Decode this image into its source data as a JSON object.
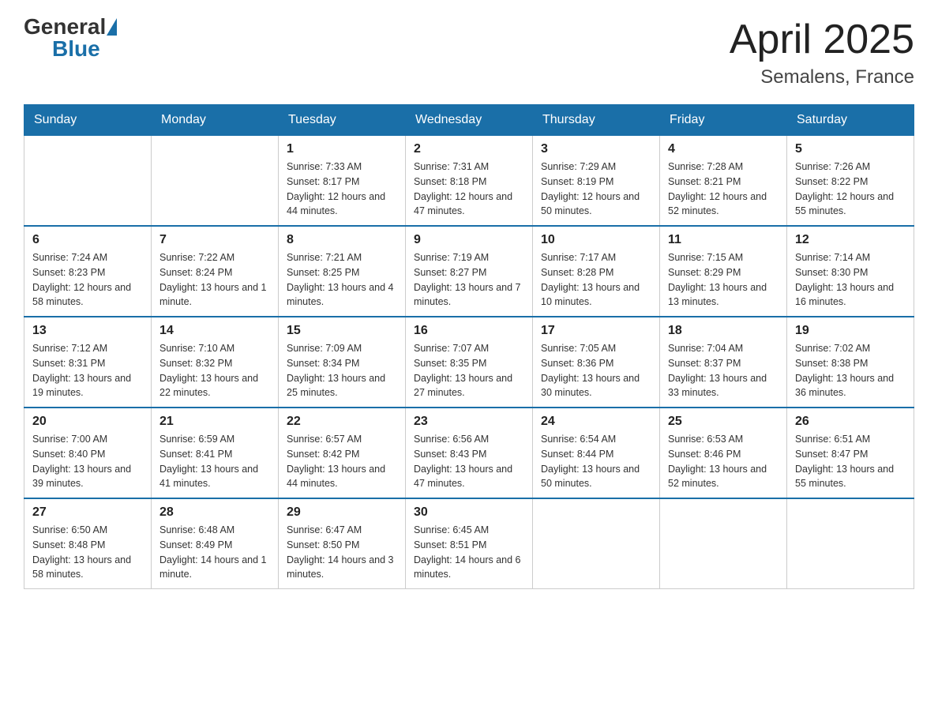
{
  "header": {
    "logo_general": "General",
    "logo_blue": "Blue",
    "month_year": "April 2025",
    "location": "Semalens, France"
  },
  "days_of_week": [
    "Sunday",
    "Monday",
    "Tuesday",
    "Wednesday",
    "Thursday",
    "Friday",
    "Saturday"
  ],
  "weeks": [
    [
      {
        "day": "",
        "sunrise": "",
        "sunset": "",
        "daylight": ""
      },
      {
        "day": "",
        "sunrise": "",
        "sunset": "",
        "daylight": ""
      },
      {
        "day": "1",
        "sunrise": "Sunrise: 7:33 AM",
        "sunset": "Sunset: 8:17 PM",
        "daylight": "Daylight: 12 hours and 44 minutes."
      },
      {
        "day": "2",
        "sunrise": "Sunrise: 7:31 AM",
        "sunset": "Sunset: 8:18 PM",
        "daylight": "Daylight: 12 hours and 47 minutes."
      },
      {
        "day": "3",
        "sunrise": "Sunrise: 7:29 AM",
        "sunset": "Sunset: 8:19 PM",
        "daylight": "Daylight: 12 hours and 50 minutes."
      },
      {
        "day": "4",
        "sunrise": "Sunrise: 7:28 AM",
        "sunset": "Sunset: 8:21 PM",
        "daylight": "Daylight: 12 hours and 52 minutes."
      },
      {
        "day": "5",
        "sunrise": "Sunrise: 7:26 AM",
        "sunset": "Sunset: 8:22 PM",
        "daylight": "Daylight: 12 hours and 55 minutes."
      }
    ],
    [
      {
        "day": "6",
        "sunrise": "Sunrise: 7:24 AM",
        "sunset": "Sunset: 8:23 PM",
        "daylight": "Daylight: 12 hours and 58 minutes."
      },
      {
        "day": "7",
        "sunrise": "Sunrise: 7:22 AM",
        "sunset": "Sunset: 8:24 PM",
        "daylight": "Daylight: 13 hours and 1 minute."
      },
      {
        "day": "8",
        "sunrise": "Sunrise: 7:21 AM",
        "sunset": "Sunset: 8:25 PM",
        "daylight": "Daylight: 13 hours and 4 minutes."
      },
      {
        "day": "9",
        "sunrise": "Sunrise: 7:19 AM",
        "sunset": "Sunset: 8:27 PM",
        "daylight": "Daylight: 13 hours and 7 minutes."
      },
      {
        "day": "10",
        "sunrise": "Sunrise: 7:17 AM",
        "sunset": "Sunset: 8:28 PM",
        "daylight": "Daylight: 13 hours and 10 minutes."
      },
      {
        "day": "11",
        "sunrise": "Sunrise: 7:15 AM",
        "sunset": "Sunset: 8:29 PM",
        "daylight": "Daylight: 13 hours and 13 minutes."
      },
      {
        "day": "12",
        "sunrise": "Sunrise: 7:14 AM",
        "sunset": "Sunset: 8:30 PM",
        "daylight": "Daylight: 13 hours and 16 minutes."
      }
    ],
    [
      {
        "day": "13",
        "sunrise": "Sunrise: 7:12 AM",
        "sunset": "Sunset: 8:31 PM",
        "daylight": "Daylight: 13 hours and 19 minutes."
      },
      {
        "day": "14",
        "sunrise": "Sunrise: 7:10 AM",
        "sunset": "Sunset: 8:32 PM",
        "daylight": "Daylight: 13 hours and 22 minutes."
      },
      {
        "day": "15",
        "sunrise": "Sunrise: 7:09 AM",
        "sunset": "Sunset: 8:34 PM",
        "daylight": "Daylight: 13 hours and 25 minutes."
      },
      {
        "day": "16",
        "sunrise": "Sunrise: 7:07 AM",
        "sunset": "Sunset: 8:35 PM",
        "daylight": "Daylight: 13 hours and 27 minutes."
      },
      {
        "day": "17",
        "sunrise": "Sunrise: 7:05 AM",
        "sunset": "Sunset: 8:36 PM",
        "daylight": "Daylight: 13 hours and 30 minutes."
      },
      {
        "day": "18",
        "sunrise": "Sunrise: 7:04 AM",
        "sunset": "Sunset: 8:37 PM",
        "daylight": "Daylight: 13 hours and 33 minutes."
      },
      {
        "day": "19",
        "sunrise": "Sunrise: 7:02 AM",
        "sunset": "Sunset: 8:38 PM",
        "daylight": "Daylight: 13 hours and 36 minutes."
      }
    ],
    [
      {
        "day": "20",
        "sunrise": "Sunrise: 7:00 AM",
        "sunset": "Sunset: 8:40 PM",
        "daylight": "Daylight: 13 hours and 39 minutes."
      },
      {
        "day": "21",
        "sunrise": "Sunrise: 6:59 AM",
        "sunset": "Sunset: 8:41 PM",
        "daylight": "Daylight: 13 hours and 41 minutes."
      },
      {
        "day": "22",
        "sunrise": "Sunrise: 6:57 AM",
        "sunset": "Sunset: 8:42 PM",
        "daylight": "Daylight: 13 hours and 44 minutes."
      },
      {
        "day": "23",
        "sunrise": "Sunrise: 6:56 AM",
        "sunset": "Sunset: 8:43 PM",
        "daylight": "Daylight: 13 hours and 47 minutes."
      },
      {
        "day": "24",
        "sunrise": "Sunrise: 6:54 AM",
        "sunset": "Sunset: 8:44 PM",
        "daylight": "Daylight: 13 hours and 50 minutes."
      },
      {
        "day": "25",
        "sunrise": "Sunrise: 6:53 AM",
        "sunset": "Sunset: 8:46 PM",
        "daylight": "Daylight: 13 hours and 52 minutes."
      },
      {
        "day": "26",
        "sunrise": "Sunrise: 6:51 AM",
        "sunset": "Sunset: 8:47 PM",
        "daylight": "Daylight: 13 hours and 55 minutes."
      }
    ],
    [
      {
        "day": "27",
        "sunrise": "Sunrise: 6:50 AM",
        "sunset": "Sunset: 8:48 PM",
        "daylight": "Daylight: 13 hours and 58 minutes."
      },
      {
        "day": "28",
        "sunrise": "Sunrise: 6:48 AM",
        "sunset": "Sunset: 8:49 PM",
        "daylight": "Daylight: 14 hours and 1 minute."
      },
      {
        "day": "29",
        "sunrise": "Sunrise: 6:47 AM",
        "sunset": "Sunset: 8:50 PM",
        "daylight": "Daylight: 14 hours and 3 minutes."
      },
      {
        "day": "30",
        "sunrise": "Sunrise: 6:45 AM",
        "sunset": "Sunset: 8:51 PM",
        "daylight": "Daylight: 14 hours and 6 minutes."
      },
      {
        "day": "",
        "sunrise": "",
        "sunset": "",
        "daylight": ""
      },
      {
        "day": "",
        "sunrise": "",
        "sunset": "",
        "daylight": ""
      },
      {
        "day": "",
        "sunrise": "",
        "sunset": "",
        "daylight": ""
      }
    ]
  ]
}
